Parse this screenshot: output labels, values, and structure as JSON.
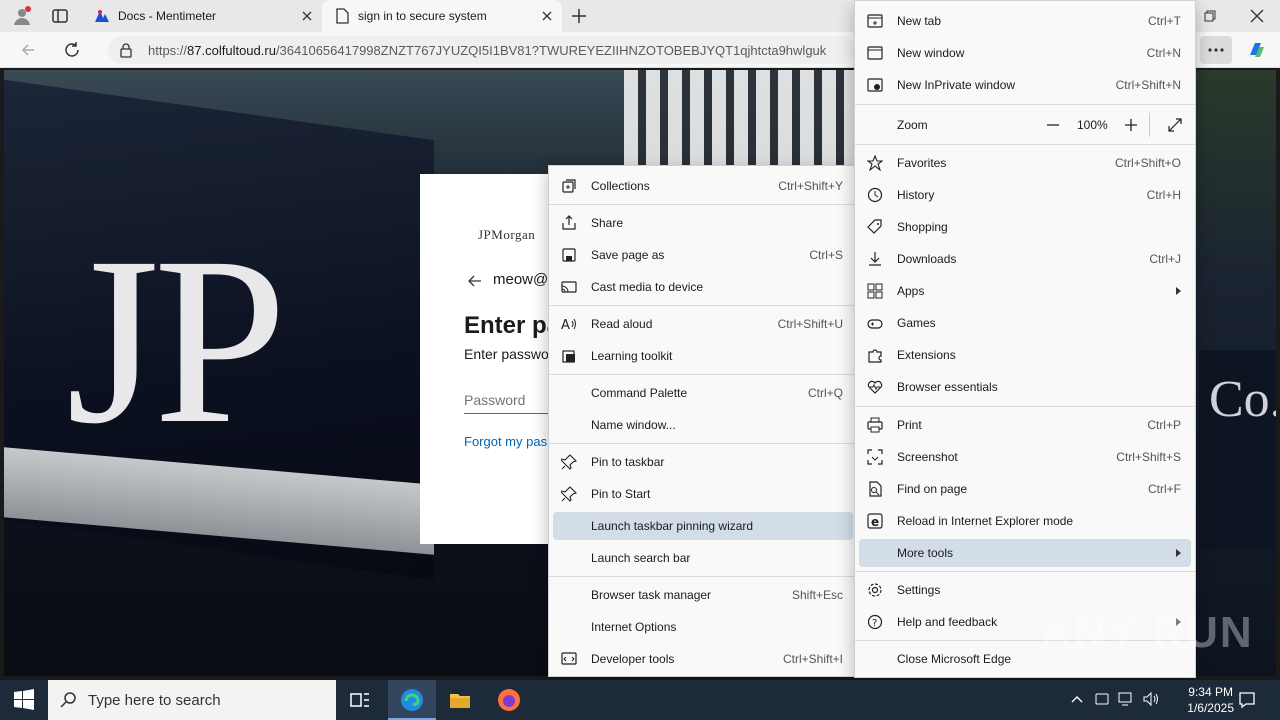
{
  "tabs": [
    {
      "title": "Docs - Mentimeter"
    },
    {
      "title": "sign in to secure system"
    }
  ],
  "address": {
    "scheme": "https://",
    "host": "87.colfultoud.ru",
    "path": "/36410656417998ZNZT767JYUZQI5I1BV81?TWUREYEZIIHNZOTOBEBJYQT1qjhtcta9hwlguk"
  },
  "page": {
    "brand": "JPMorgan",
    "email": "meow@",
    "heading": "Enter pa",
    "subtext": "Enter passwo",
    "password_placeholder": "Password",
    "forgot": "Forgot my pas",
    "jp_text": "JP",
    "co_text": "Co."
  },
  "submenu": {
    "items": [
      {
        "label": "Collections",
        "shortcut": "Ctrl+Shift+Y",
        "icon": "collections-icon"
      },
      {
        "label": "Share",
        "shortcut": "",
        "icon": "share-icon"
      },
      {
        "label": "Save page as",
        "shortcut": "Ctrl+S",
        "icon": "save-icon"
      },
      {
        "label": "Cast media to device",
        "shortcut": "",
        "icon": "cast-icon"
      },
      {
        "label": "Read aloud",
        "shortcut": "Ctrl+Shift+U",
        "icon": "read-aloud-icon"
      },
      {
        "label": "Learning toolkit",
        "shortcut": "",
        "icon": "learning-icon"
      },
      {
        "label": "Command Palette",
        "shortcut": "Ctrl+Q",
        "icon": ""
      },
      {
        "label": "Name window...",
        "shortcut": "",
        "icon": ""
      },
      {
        "label": "Pin to taskbar",
        "shortcut": "",
        "icon": "pin-icon"
      },
      {
        "label": "Pin to Start",
        "shortcut": "",
        "icon": "pin-icon"
      },
      {
        "label": "Launch taskbar pinning wizard",
        "shortcut": "",
        "icon": ""
      },
      {
        "label": "Launch search bar",
        "shortcut": "",
        "icon": ""
      },
      {
        "label": "Browser task manager",
        "shortcut": "Shift+Esc",
        "icon": ""
      },
      {
        "label": "Internet Options",
        "shortcut": "",
        "icon": ""
      },
      {
        "label": "Developer tools",
        "shortcut": "Ctrl+Shift+I",
        "icon": "devtools-icon"
      }
    ]
  },
  "mainmenu": {
    "items": [
      {
        "label": "New tab",
        "shortcut": "Ctrl+T",
        "icon": "new-tab-icon"
      },
      {
        "label": "New window",
        "shortcut": "Ctrl+N",
        "icon": "new-window-icon"
      },
      {
        "label": "New InPrivate window",
        "shortcut": "Ctrl+Shift+N",
        "icon": "inprivate-icon"
      },
      {
        "label": "Favorites",
        "shortcut": "Ctrl+Shift+O",
        "icon": "star-icon"
      },
      {
        "label": "History",
        "shortcut": "Ctrl+H",
        "icon": "history-icon"
      },
      {
        "label": "Shopping",
        "shortcut": "",
        "icon": "tag-icon"
      },
      {
        "label": "Downloads",
        "shortcut": "Ctrl+J",
        "icon": "download-icon"
      },
      {
        "label": "Apps",
        "shortcut": "",
        "icon": "apps-icon"
      },
      {
        "label": "Games",
        "shortcut": "",
        "icon": "gamepad-icon"
      },
      {
        "label": "Extensions",
        "shortcut": "",
        "icon": "puzzle-icon"
      },
      {
        "label": "Browser essentials",
        "shortcut": "",
        "icon": "heart-pulse-icon"
      },
      {
        "label": "Print",
        "shortcut": "Ctrl+P",
        "icon": "print-icon"
      },
      {
        "label": "Screenshot",
        "shortcut": "Ctrl+Shift+S",
        "icon": "screenshot-icon"
      },
      {
        "label": "Find on page",
        "shortcut": "Ctrl+F",
        "icon": "find-icon"
      },
      {
        "label": "Reload in Internet Explorer mode",
        "shortcut": "",
        "icon": "ie-icon"
      },
      {
        "label": "More tools",
        "shortcut": "",
        "icon": ""
      },
      {
        "label": "Settings",
        "shortcut": "",
        "icon": "gear-icon"
      },
      {
        "label": "Help and feedback",
        "shortcut": "",
        "icon": "help-icon"
      },
      {
        "label": "Close Microsoft Edge",
        "shortcut": "",
        "icon": ""
      }
    ],
    "zoom": {
      "label": "Zoom",
      "value": "100%",
      "minus": "—",
      "plus": "+"
    }
  },
  "taskbar": {
    "search_placeholder": "Type here to search",
    "time": "9:34 PM",
    "date": "1/6/2025"
  },
  "watermark": "ANY RUN"
}
